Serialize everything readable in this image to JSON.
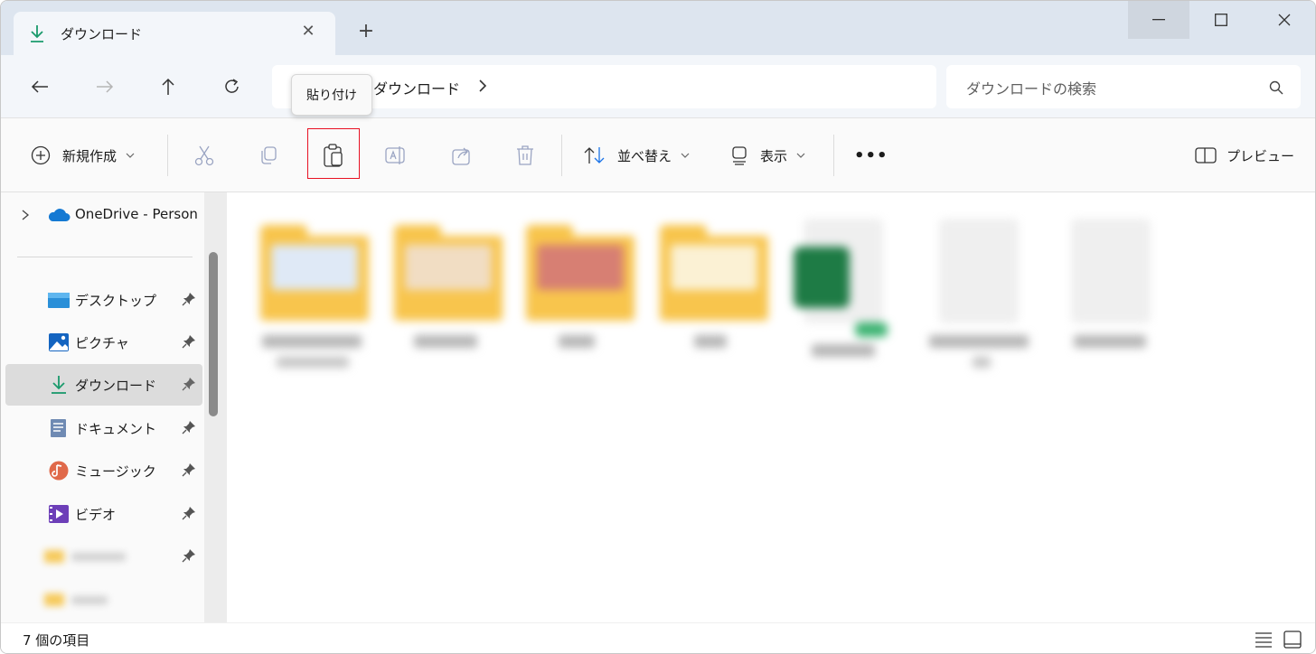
{
  "tab": {
    "title": "ダウンロード",
    "close": "✕",
    "new_tab": "+"
  },
  "address": {
    "crumb": "ダウンロード"
  },
  "search": {
    "placeholder": "ダウンロードの検索"
  },
  "tooltip": "貼り付け",
  "toolbar": {
    "new_label": "新規作成",
    "sort_label": "並べ替え",
    "view_label": "表示",
    "more": "•••",
    "preview_label": "プレビュー"
  },
  "sidebar": {
    "onedrive": "OneDrive - Person",
    "items": [
      {
        "label": "デスクトップ"
      },
      {
        "label": "ピクチャ"
      },
      {
        "label": "ダウンロード"
      },
      {
        "label": "ドキュメント"
      },
      {
        "label": "ミュージック"
      },
      {
        "label": "ビデオ"
      }
    ]
  },
  "status": {
    "count": "7 個の項目"
  },
  "colors": {
    "accent": "#0e8a62",
    "highlight": "#e81123",
    "folder": "#f8c54d"
  }
}
